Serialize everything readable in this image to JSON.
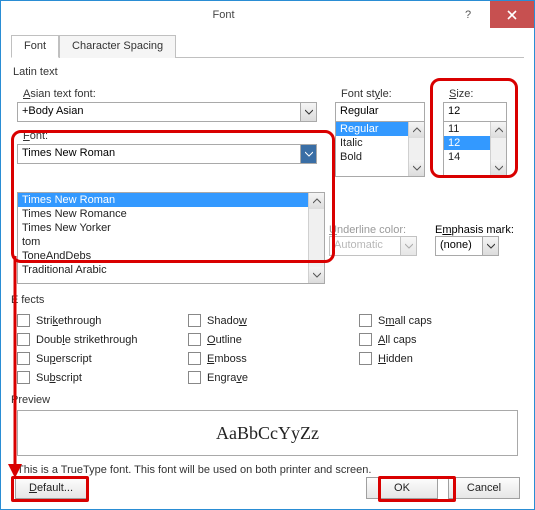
{
  "titlebar": {
    "title": "Font",
    "help": "?",
    "close": "×"
  },
  "tabs": {
    "font": "Font",
    "spacing": "Character Spacing"
  },
  "labels": {
    "latin_text": "Latin text",
    "asian_font": "Asian text font:",
    "asian_font_acc": "A",
    "font_style": "Font style:",
    "size": "Size:",
    "font": "Font:",
    "underline_color": "Underline color:",
    "emphasis_mark": "Emphasis mark:",
    "effects": "Effects",
    "preview": "Preview"
  },
  "asian_font": {
    "value": "+Body Asian"
  },
  "font": {
    "value": "Times New Roman",
    "options": [
      "Times New Roman",
      "Times New Romance",
      "Times New Yorker",
      "tom",
      "ToneAndDebs",
      "Traditional Arabic"
    ]
  },
  "font_style": {
    "value": "Regular",
    "options": [
      "Regular",
      "Italic",
      "Bold"
    ],
    "selected": "Regular"
  },
  "size": {
    "value": "12",
    "options": [
      "11",
      "12",
      "14"
    ],
    "selected": "12"
  },
  "underline_color": {
    "value": "Automatic"
  },
  "emphasis_mark": {
    "value": "(none)"
  },
  "effects": {
    "strikethrough": "Strikethrough",
    "double_strike": "Double strikethrough",
    "superscript": "Superscript",
    "subscript": "Subscript",
    "shadow": "Shadow",
    "outline": "Outline",
    "emboss": "Emboss",
    "engrave": "Engrave",
    "small_caps": "Small caps",
    "all_caps": "All caps",
    "hidden": "Hidden"
  },
  "preview_text": "AaBbCcYyZz",
  "note": "This is a TrueType font. This font will be used on both printer and screen.",
  "buttons": {
    "default": "Default...",
    "ok": "OK",
    "cancel": "Cancel"
  }
}
